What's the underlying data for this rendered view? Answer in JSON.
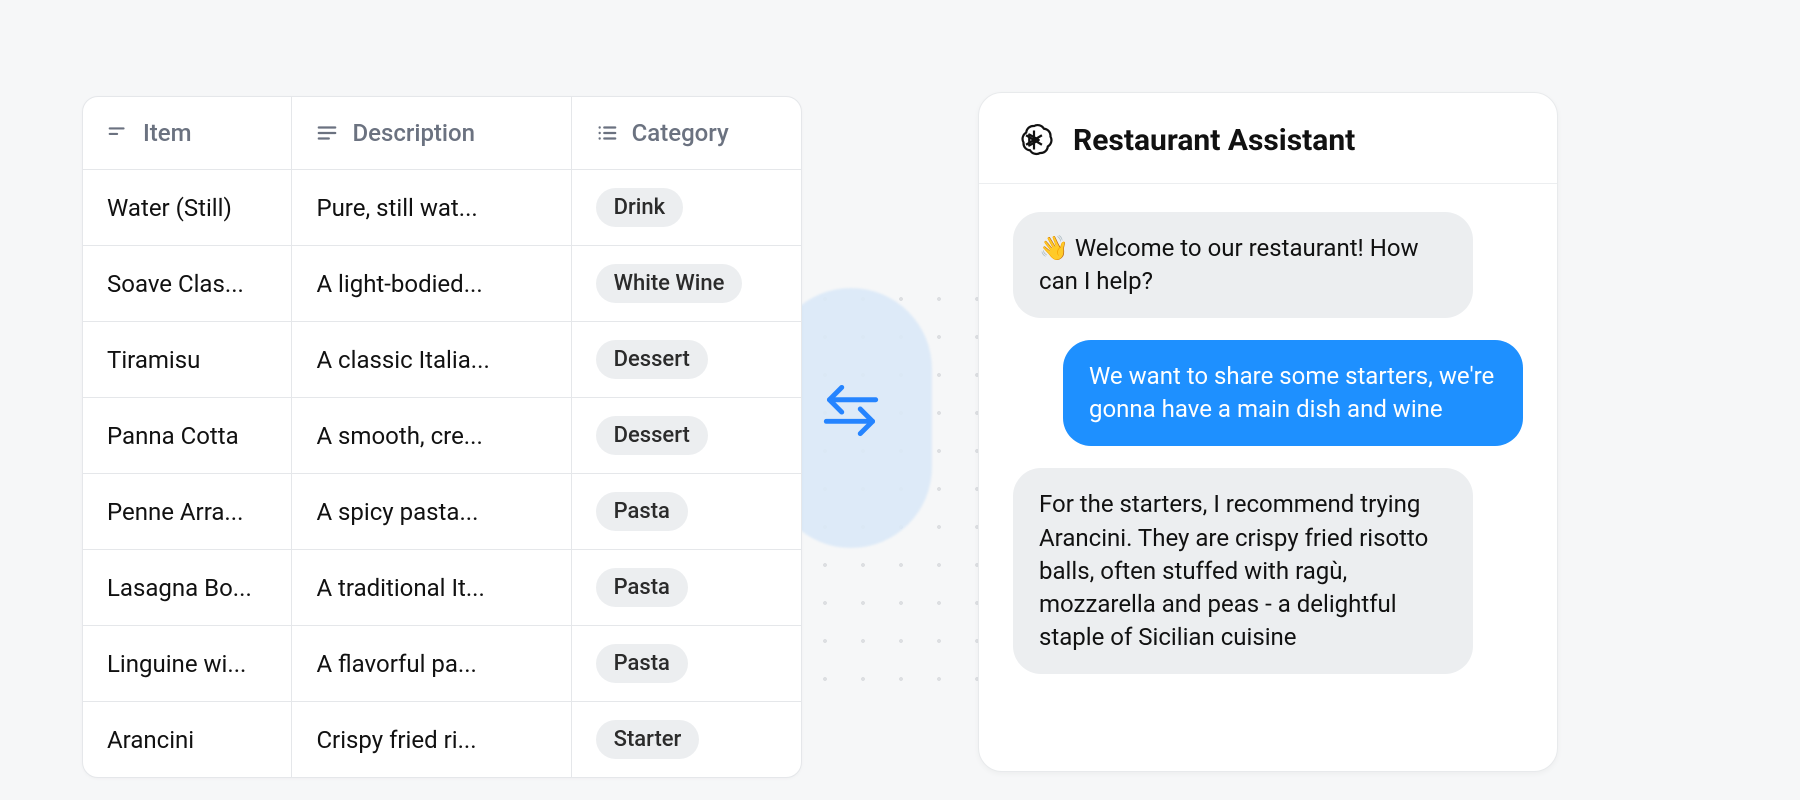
{
  "table": {
    "headers": {
      "item": "Item",
      "description": "Description",
      "category": "Category"
    },
    "rows": [
      {
        "item": "Water (Still)",
        "description": "Pure, still wat...",
        "category": "Drink"
      },
      {
        "item": "Soave Clas...",
        "description": "A light-bodied...",
        "category": "White Wine"
      },
      {
        "item": "Tiramisu",
        "description": "A classic Italia...",
        "category": "Dessert"
      },
      {
        "item": "Panna Cotta",
        "description": "A smooth, cre...",
        "category": "Dessert"
      },
      {
        "item": "Penne Arra...",
        "description": "A spicy pasta...",
        "category": "Pasta"
      },
      {
        "item": "Lasagna Bo...",
        "description": "A traditional It...",
        "category": "Pasta"
      },
      {
        "item": "Linguine wi...",
        "description": "A flavorful pa...",
        "category": "Pasta"
      },
      {
        "item": "Arancini",
        "description": "Crispy fried ri...",
        "category": "Starter"
      }
    ]
  },
  "chat": {
    "title": "Restaurant Assistant",
    "messages": {
      "m0": {
        "role": "bot",
        "text": "👋 Welcome to our restaurant! How can I help?"
      },
      "m1": {
        "role": "user",
        "text": "We want to share some starters, we're gonna have a main dish and wine"
      },
      "m2": {
        "role": "bot",
        "text": "For the starters, I recommend trying Arancini. They are crispy fried risotto balls, often stuffed with ragù, mozzarella and peas - a delightful staple of Sicilian cuisine"
      }
    }
  },
  "colors": {
    "accent": "#1e90ff",
    "badge_bg": "#eceef0"
  }
}
